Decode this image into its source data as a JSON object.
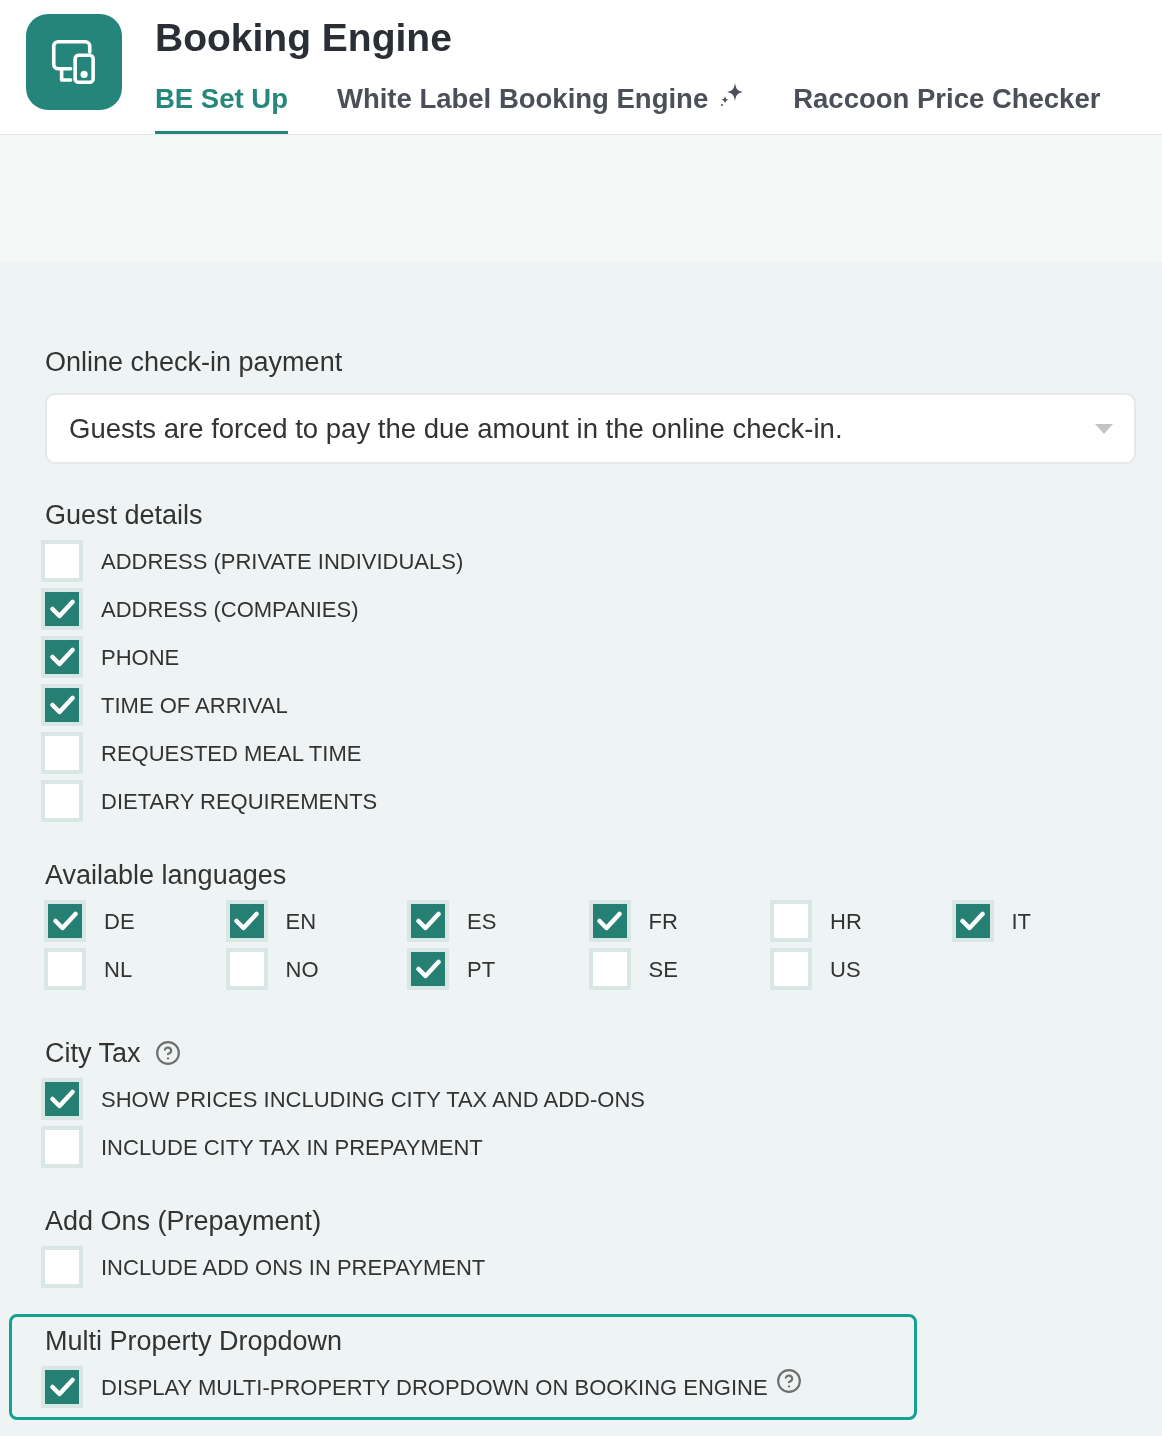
{
  "app": {
    "title": "Booking Engine"
  },
  "tabs": [
    {
      "label": "BE Set Up",
      "selected": true,
      "kind": "plain"
    },
    {
      "label": "White Label Booking Engine",
      "selected": false,
      "kind": "sparkle"
    },
    {
      "label": "Raccoon Price Checker",
      "selected": false,
      "kind": "plain"
    }
  ],
  "sections": [
    {
      "kind": "select",
      "label": "Online check-in payment",
      "value": "Guests are forced to pay the due amount in the online check-in.",
      "help": false,
      "highlighted": false
    },
    {
      "kind": "checklist",
      "label": "Guest details",
      "help": false,
      "highlighted": false,
      "options": [
        {
          "label": "ADDRESS (PRIVATE INDIVIDUALS)",
          "checked": false,
          "help": false
        },
        {
          "label": "ADDRESS (COMPANIES)",
          "checked": true,
          "help": false
        },
        {
          "label": "PHONE",
          "checked": true,
          "help": false
        },
        {
          "label": "TIME OF ARRIVAL",
          "checked": true,
          "help": false
        },
        {
          "label": "REQUESTED MEAL TIME",
          "checked": false,
          "help": false
        },
        {
          "label": "DIETARY REQUIREMENTS",
          "checked": false,
          "help": false
        }
      ]
    },
    {
      "kind": "grid",
      "label": "Available languages",
      "help": false,
      "highlighted": false,
      "options": [
        {
          "label": "DE",
          "checked": true
        },
        {
          "label": "EN",
          "checked": true
        },
        {
          "label": "ES",
          "checked": true
        },
        {
          "label": "FR",
          "checked": true
        },
        {
          "label": "HR",
          "checked": false
        },
        {
          "label": "IT",
          "checked": true
        },
        {
          "label": "NL",
          "checked": false
        },
        {
          "label": "NO",
          "checked": false
        },
        {
          "label": "PT",
          "checked": true
        },
        {
          "label": "SE",
          "checked": false
        },
        {
          "label": "US",
          "checked": false
        }
      ]
    },
    {
      "kind": "checklist",
      "label": "City Tax",
      "help": true,
      "highlighted": false,
      "options": [
        {
          "label": "SHOW PRICES INCLUDING CITY TAX AND ADD-ONS",
          "checked": true,
          "help": false
        },
        {
          "label": "INCLUDE CITY TAX IN PREPAYMENT",
          "checked": false,
          "help": false
        }
      ]
    },
    {
      "kind": "checklist",
      "label": "Add Ons (Prepayment)",
      "help": false,
      "highlighted": false,
      "options": [
        {
          "label": "INCLUDE ADD ONS IN PREPAYMENT",
          "checked": false,
          "help": false
        }
      ]
    },
    {
      "kind": "checklist",
      "label": "Multi Property Dropdown",
      "help": false,
      "highlighted": true,
      "options": [
        {
          "label": "DISPLAY MULTI-PROPERTY DROPDOWN ON BOOKING ENGINE",
          "checked": true,
          "help": true
        }
      ]
    }
  ]
}
